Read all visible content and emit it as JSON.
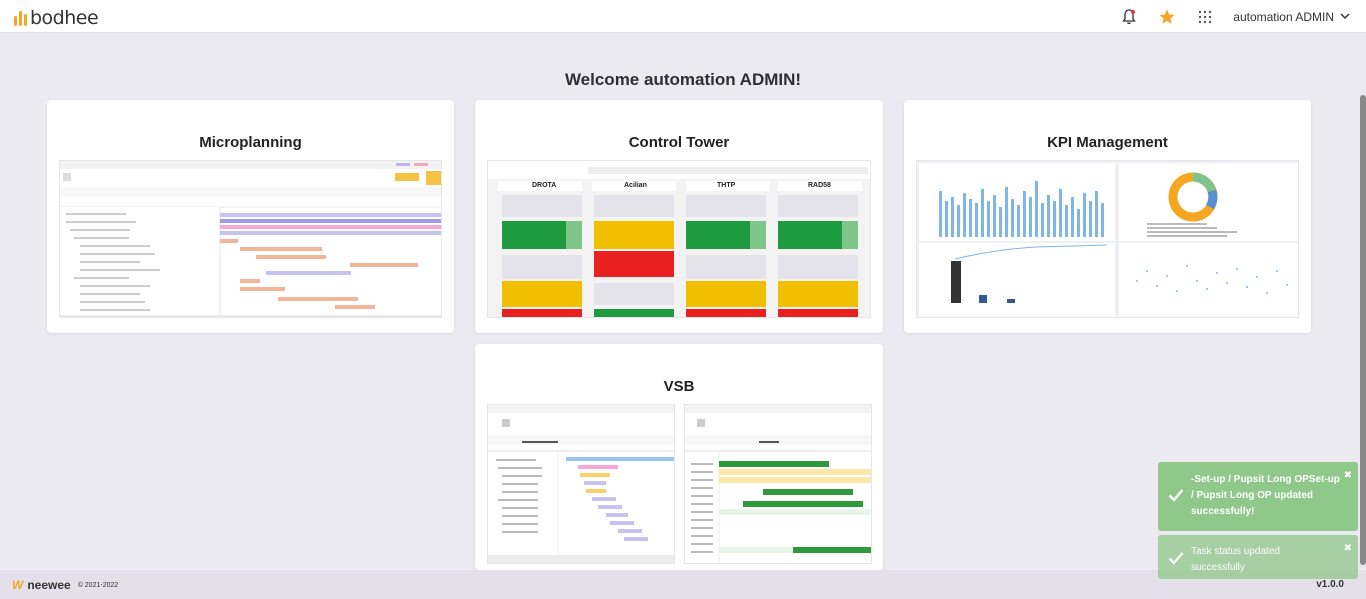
{
  "header": {
    "logo_text": "bodhee",
    "user_name": "automation ADMIN"
  },
  "welcome": "Welcome automation ADMIN!",
  "cards": [
    {
      "title": "Microplanning"
    },
    {
      "title": "Control Tower"
    },
    {
      "title": "KPI Management"
    },
    {
      "title": "VSB"
    }
  ],
  "control_tower_preview": {
    "columns": [
      "DROTA",
      "Acilian",
      "THTP",
      "RAD58"
    ]
  },
  "footer": {
    "brand": "neewee",
    "copyright": "© 2021-2022",
    "version": "v1.0.0"
  },
  "toasts": [
    {
      "message": "-Set-up / Pupsit Long OPSet-up / Pupsit Long OP updated successfully!"
    },
    {
      "message": "Task status updated successfully"
    }
  ],
  "colors": {
    "accent": "#f5a623",
    "toast_green": "#8fc88a",
    "background": "#eceaf1"
  }
}
